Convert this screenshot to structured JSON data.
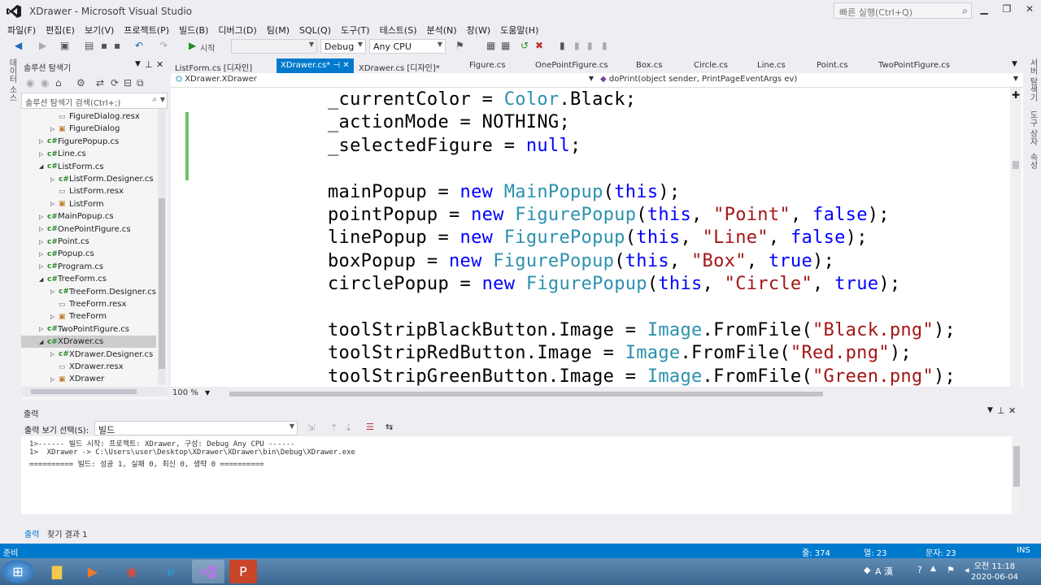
{
  "window": {
    "title": "XDrawer - Microsoft Visual Studio",
    "quick_launch_placeholder": "빠른 실행(Ctrl+Q)",
    "vs_color": "#68217a"
  },
  "menu": [
    "파일(F)",
    "편집(E)",
    "보기(V)",
    "프로젝트(P)",
    "빌드(B)",
    "디버그(D)",
    "팀(M)",
    "SQL(Q)",
    "도구(T)",
    "테스트(S)",
    "분석(N)",
    "창(W)",
    "도움말(H)"
  ],
  "toolbar": {
    "start_label": "시작",
    "config": "Debug",
    "platform": "Any CPU"
  },
  "side_tabs": {
    "left": "데이터 소스",
    "right1": "서버 탐색기",
    "right2": "도구 상자",
    "right3": "속성"
  },
  "solution_explorer": {
    "title": "솔루션 탐색기",
    "search_placeholder": "솔루션 탐색기 검색(Ctrl+;)",
    "items": [
      {
        "label": "FigureDialog.resx",
        "level": 2,
        "expander": "",
        "icon": "res"
      },
      {
        "label": "FigureDialog",
        "level": 2,
        "expander": "collapsed",
        "icon": "form"
      },
      {
        "label": "FigurePopup.cs",
        "level": 1,
        "expander": "collapsed",
        "icon": "cs"
      },
      {
        "label": "Line.cs",
        "level": 1,
        "expander": "collapsed",
        "icon": "cs"
      },
      {
        "label": "ListForm.cs",
        "level": 1,
        "expander": "expanded",
        "icon": "cs"
      },
      {
        "label": "ListForm.Designer.cs",
        "level": 2,
        "expander": "collapsed",
        "icon": "cs"
      },
      {
        "label": "ListForm.resx",
        "level": 2,
        "expander": "",
        "icon": "res"
      },
      {
        "label": "ListForm",
        "level": 2,
        "expander": "collapsed",
        "icon": "form"
      },
      {
        "label": "MainPopup.cs",
        "level": 1,
        "expander": "collapsed",
        "icon": "cs"
      },
      {
        "label": "OnePointFigure.cs",
        "level": 1,
        "expander": "collapsed",
        "icon": "cs"
      },
      {
        "label": "Point.cs",
        "level": 1,
        "expander": "collapsed",
        "icon": "cs"
      },
      {
        "label": "Popup.cs",
        "level": 1,
        "expander": "collapsed",
        "icon": "cs"
      },
      {
        "label": "Program.cs",
        "level": 1,
        "expander": "collapsed",
        "icon": "cs"
      },
      {
        "label": "TreeForm.cs",
        "level": 1,
        "expander": "expanded",
        "icon": "cs"
      },
      {
        "label": "TreeForm.Designer.cs",
        "level": 2,
        "expander": "collapsed",
        "icon": "cs"
      },
      {
        "label": "TreeForm.resx",
        "level": 2,
        "expander": "",
        "icon": "res"
      },
      {
        "label": "TreeForm",
        "level": 2,
        "expander": "collapsed",
        "icon": "form"
      },
      {
        "label": "TwoPointFigure.cs",
        "level": 1,
        "expander": "collapsed",
        "icon": "cs"
      },
      {
        "label": "XDrawer.cs",
        "level": 1,
        "expander": "expanded",
        "icon": "cs",
        "selected": true
      },
      {
        "label": "XDrawer.Designer.cs",
        "level": 2,
        "expander": "collapsed",
        "icon": "cs"
      },
      {
        "label": "XDrawer.resx",
        "level": 2,
        "expander": "",
        "icon": "res"
      },
      {
        "label": "XDrawer",
        "level": 2,
        "expander": "collapsed",
        "icon": "form"
      }
    ]
  },
  "doc_tabs": [
    {
      "label": "ListForm.cs [디자인]",
      "active": false
    },
    {
      "label": "XDrawer.cs*",
      "active": true
    },
    {
      "label": "XDrawer.cs [디자인]*",
      "active": false
    },
    {
      "label": "Figure.cs",
      "active": false
    },
    {
      "label": "OnePointFigure.cs",
      "active": false
    },
    {
      "label": "Box.cs",
      "active": false
    },
    {
      "label": "Circle.cs",
      "active": false
    },
    {
      "label": "Line.cs",
      "active": false
    },
    {
      "label": "Point.cs",
      "active": false
    },
    {
      "label": "TwoPointFigure.cs",
      "active": false
    }
  ],
  "nav": {
    "type": "XDrawer.XDrawer",
    "member": "doPrint(object sender, PrintPageEventArgs ev)"
  },
  "code_lines": [
    [
      {
        "t": "_currentColor = "
      },
      {
        "t": "Color",
        "c": "t"
      },
      {
        "t": ".Black;"
      }
    ],
    [
      {
        "t": "_actionMode = NOTHING;"
      }
    ],
    [
      {
        "t": "_selectedFigure = "
      },
      {
        "t": "null",
        "c": "k"
      },
      {
        "t": ";"
      }
    ],
    [],
    [
      {
        "t": "mainPopup = "
      },
      {
        "t": "new",
        "c": "k"
      },
      {
        "t": " "
      },
      {
        "t": "MainPopup",
        "c": "t"
      },
      {
        "t": "("
      },
      {
        "t": "this",
        "c": "k"
      },
      {
        "t": ");"
      }
    ],
    [
      {
        "t": "pointPopup = "
      },
      {
        "t": "new",
        "c": "k"
      },
      {
        "t": " "
      },
      {
        "t": "FigurePopup",
        "c": "t"
      },
      {
        "t": "("
      },
      {
        "t": "this",
        "c": "k"
      },
      {
        "t": ", "
      },
      {
        "t": "\"Point\"",
        "c": "s"
      },
      {
        "t": ", "
      },
      {
        "t": "false",
        "c": "k"
      },
      {
        "t": ");"
      }
    ],
    [
      {
        "t": "linePopup = "
      },
      {
        "t": "new",
        "c": "k"
      },
      {
        "t": " "
      },
      {
        "t": "FigurePopup",
        "c": "t"
      },
      {
        "t": "("
      },
      {
        "t": "this",
        "c": "k"
      },
      {
        "t": ", "
      },
      {
        "t": "\"Line\"",
        "c": "s"
      },
      {
        "t": ", "
      },
      {
        "t": "false",
        "c": "k"
      },
      {
        "t": ");"
      }
    ],
    [
      {
        "t": "boxPopup = "
      },
      {
        "t": "new",
        "c": "k"
      },
      {
        "t": " "
      },
      {
        "t": "FigurePopup",
        "c": "t"
      },
      {
        "t": "("
      },
      {
        "t": "this",
        "c": "k"
      },
      {
        "t": ", "
      },
      {
        "t": "\"Box\"",
        "c": "s"
      },
      {
        "t": ", "
      },
      {
        "t": "true",
        "c": "k"
      },
      {
        "t": ");"
      }
    ],
    [
      {
        "t": "circlePopup = "
      },
      {
        "t": "new",
        "c": "k"
      },
      {
        "t": " "
      },
      {
        "t": "FigurePopup",
        "c": "t"
      },
      {
        "t": "("
      },
      {
        "t": "this",
        "c": "k"
      },
      {
        "t": ", "
      },
      {
        "t": "\"Circle\"",
        "c": "s"
      },
      {
        "t": ", "
      },
      {
        "t": "true",
        "c": "k"
      },
      {
        "t": ");"
      }
    ],
    [],
    [
      {
        "t": "toolStripBlackButton.Image = "
      },
      {
        "t": "Image",
        "c": "t"
      },
      {
        "t": ".FromFile("
      },
      {
        "t": "\"Black.png\"",
        "c": "s"
      },
      {
        "t": ");"
      }
    ],
    [
      {
        "t": "toolStripRedButton.Image = "
      },
      {
        "t": "Image",
        "c": "t"
      },
      {
        "t": ".FromFile("
      },
      {
        "t": "\"Red.png\"",
        "c": "s"
      },
      {
        "t": ");"
      }
    ],
    [
      {
        "t": "toolStripGreenButton.Image = "
      },
      {
        "t": "Image",
        "c": "t"
      },
      {
        "t": ".FromFile("
      },
      {
        "t": "\"Green.png\"",
        "c": "s"
      },
      {
        "t": ");"
      }
    ]
  ],
  "editor": {
    "zoom": "100 %"
  },
  "output": {
    "title": "출력",
    "select_label": "출력 보기 선택(S):",
    "select_value": "빌드",
    "lines": [
      "1>------ 빌드 시작: 프로젝트: XDrawer, 구성: Debug Any CPU ------",
      "1>  XDrawer -> C:\\Users\\user\\Desktop\\XDrawer\\XDrawer\\bin\\Debug\\XDrawer.exe",
      "========== 빌드: 성공 1, 실패 0, 최신 0, 생략 0 =========="
    ],
    "tabs": [
      "출력",
      "찾기 결과 1"
    ]
  },
  "status": {
    "ready": "준비",
    "line": "줄: 374",
    "col": "열: 23",
    "ch": "문자: 23",
    "mode": "INS"
  },
  "taskbar": {
    "time": "오전 11:18",
    "date": "2020-06-04",
    "ime": "A 漢"
  }
}
